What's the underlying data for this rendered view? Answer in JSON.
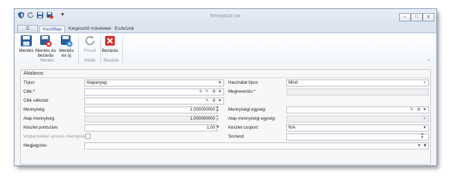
{
  "window": {
    "title": "Receptúra sor",
    "minimize": "–",
    "maximize": "□",
    "close": "x"
  },
  "quick_access": [
    "shield-icon",
    "refresh-icon",
    "save-icon",
    "save-close-icon",
    "dropdown-icon"
  ],
  "tabs": {
    "file": "☰",
    "home": "Kezdőlap",
    "finishing": "Kiegészítő műveletek",
    "tools": "Eszközök"
  },
  "ribbon": {
    "save": "Mentés",
    "save_close_l1": "Mentés és",
    "save_close_l2": "bezárás",
    "save_new_l1": "Mentés",
    "save_new_l2": "és új",
    "refresh": "Frissít",
    "close": "Bezárás",
    "group_save": "Mentés",
    "group_view": "Nézet",
    "group_close": "Bezárás"
  },
  "section_title": "Általános",
  "form": {
    "type_label": "Típus:",
    "type_value": "Alapanyag",
    "usage_type_label": "Használat típus:",
    "usage_type_value": "Mind",
    "item_label": "Cikk:*",
    "item_value": "",
    "name_label": "Megnevezés:*",
    "name_value": "",
    "variant_label": "Cikk változat:",
    "variant_value": "",
    "quantity_label": "Mennyiség:",
    "quantity_value": "1,000000000",
    "unit_label": "Mennyiségi egység:",
    "unit_value": "",
    "base_qty_label": "Alap mennyiség:",
    "base_qty_value": "1,000000000",
    "base_unit_label": "Alap mennyiségi egység:",
    "base_unit_value": "",
    "stock_point_label": "Készlet pontszám:",
    "stock_point_value": "1,00",
    "stock_group_label": "Készlet csoport:",
    "stock_group_value": "N/A",
    "same_qty_label": "Végtermékkel azonos mennyiség",
    "order_label": "Sorrend:",
    "order_value": "",
    "note_label": "Megjegyzés:",
    "note_value": ""
  },
  "colors": {
    "accent": "#2c5b99",
    "close_red": "#d9302c"
  }
}
